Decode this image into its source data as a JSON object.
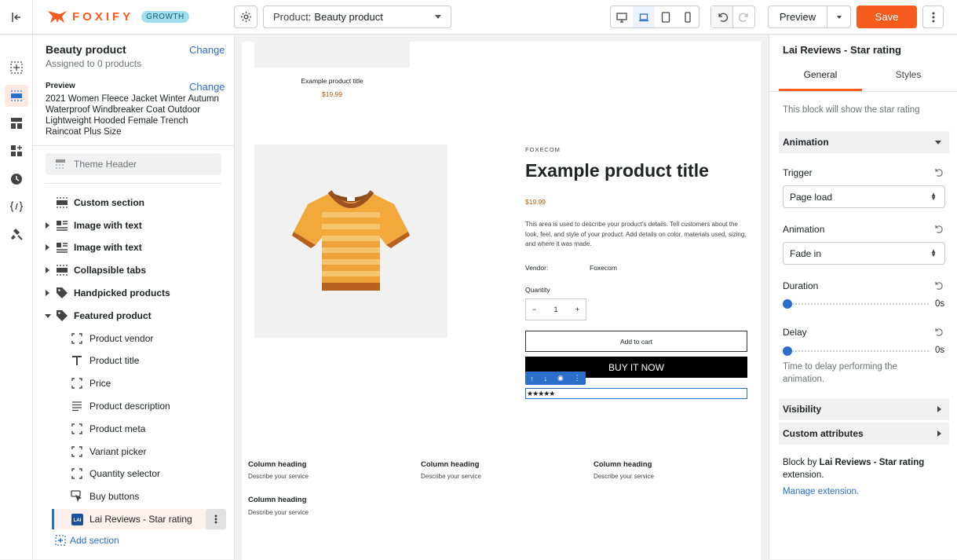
{
  "topbar": {
    "logo_text": "FOXIFY",
    "plan_badge": "GROWTH",
    "product_select_label": "Product:",
    "product_select_value": "Beauty product",
    "preview_label": "Preview",
    "save_label": "Save",
    "active_device": "laptop",
    "accent_color": "#f55a1e"
  },
  "rail": {
    "icons": [
      "exit-icon",
      "add-section-icon",
      "sections-icon",
      "layout-icon",
      "apps-icon",
      "history-icon",
      "code-icon",
      "design-icon"
    ],
    "active": "sections-icon"
  },
  "left": {
    "template_title": "Beauty product",
    "change_label": "Change",
    "assigned": "Assigned to 0 products",
    "preview_label": "Preview",
    "preview_change_label": "Change",
    "preview_text": "2021 Women Fleece Jacket Winter Autumn Waterproof Windbreaker Coat Outdoor Lightweight Hooded Female Trench Raincoat Plus Size",
    "theme_header": "Theme Header",
    "sections": [
      {
        "label": "Custom section",
        "expandable": false
      },
      {
        "label": "Image with text",
        "expandable": true
      },
      {
        "label": "Image with text",
        "expandable": true
      },
      {
        "label": "Collapsible tabs",
        "expandable": true
      },
      {
        "label": "Handpicked products",
        "expandable": true
      },
      {
        "label": "Featured product",
        "expanded": true
      }
    ],
    "blocks": [
      "Product vendor",
      "Product title",
      "Price",
      "Product description",
      "Product meta",
      "Variant picker",
      "Quantity selector",
      "Buy buttons",
      "Lai Reviews - Star rating"
    ],
    "add_section": "Add section"
  },
  "canvas": {
    "small_title": "Example product title",
    "small_price": "$19.99",
    "vendor_top": "FOXECOM",
    "title": "Example product title",
    "price": "$19.99",
    "description": "This area is used to describe your product's details. Tell customers about the look, feel, and style of your product. Add details on color, materials used, sizing, and where it was made.",
    "vendor_label": "Vendor:",
    "vendor_value": "Foxecom",
    "quantity_label": "Quantity",
    "quantity_value": "1",
    "qty_minus": "−",
    "qty_plus": "+",
    "add_to_cart": "Add to cart",
    "buy_now": "BUY IT NOW",
    "stars": "★★★★★",
    "columns": [
      {
        "heading": "Column heading",
        "desc": "Describe your service"
      },
      {
        "heading": "Column heading",
        "desc": "Describe your service"
      },
      {
        "heading": "Column heading",
        "desc": "Describe your service"
      },
      {
        "heading": "Column heading",
        "desc": "Describe your service"
      }
    ]
  },
  "right": {
    "title": "Lai Reviews - Star rating",
    "tabs": [
      "General",
      "Styles"
    ],
    "active_tab": "General",
    "description": "This block will show the star rating",
    "animation_section": "Animation",
    "trigger_label": "Trigger",
    "trigger_value": "Page load",
    "animation_label": "Animation",
    "animation_value": "Fade in",
    "duration_label": "Duration",
    "duration_value": "0s",
    "duration_fraction": 0,
    "delay_label": "Delay",
    "delay_value": "0s",
    "delay_fraction": 0,
    "delay_hint": "Time to delay performing the animation.",
    "visibility_section": "Visibility",
    "custom_attr_section": "Custom attributes",
    "block_by_prefix": "Block by",
    "block_by_name": "Lai Reviews - Star rating",
    "block_by_suffix": "extension.",
    "manage_link": "Manage extension."
  }
}
